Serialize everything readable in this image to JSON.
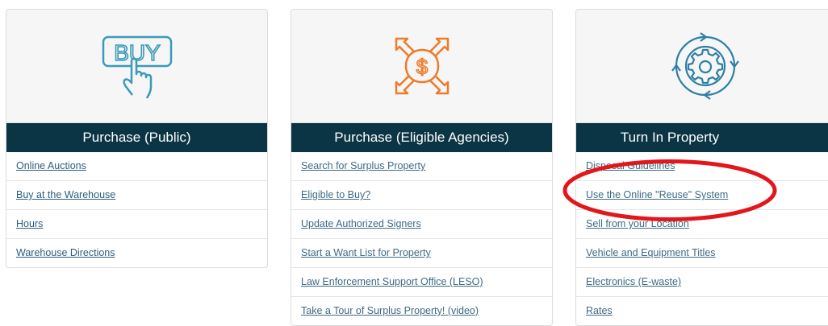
{
  "cards": [
    {
      "icon": "buy-hand-icon",
      "icon_text": "BUY",
      "title": "Purchase (Public)",
      "links": [
        "Online Auctions",
        "Buy at the Warehouse",
        "Hours",
        "Warehouse Directions"
      ]
    },
    {
      "icon": "dollar-exchange-arrows-icon",
      "icon_text": "$",
      "title": "Purchase (Eligible Agencies)",
      "links": [
        "Search for Surplus Property",
        "Eligible to Buy?",
        "Update Authorized Signers",
        "Start a Want List for Property",
        "Law Enforcement Support Office (LESO)",
        "Take a Tour of Surplus Property! (video)"
      ]
    },
    {
      "icon": "gear-cycle-icon",
      "title": "Turn In Property",
      "links": [
        "Disposal Guidelines",
        "Use the Online \"Reuse\" System",
        "Sell from your Location",
        "Vehicle and Equipment Titles",
        "Electronics (E-waste)",
        "Rates"
      ]
    }
  ],
  "colors": {
    "header_bg": "#0b3444",
    "buy_icon": "#3a9ab8",
    "exchange_icon": "#ee7a2a",
    "gear_icon": "#2e7fa6",
    "link": "#2d5d80",
    "annotation": "#e3161b"
  },
  "annotation": {
    "shape": "ellipse",
    "highlights": "Use the Online \"Reuse\" System"
  }
}
